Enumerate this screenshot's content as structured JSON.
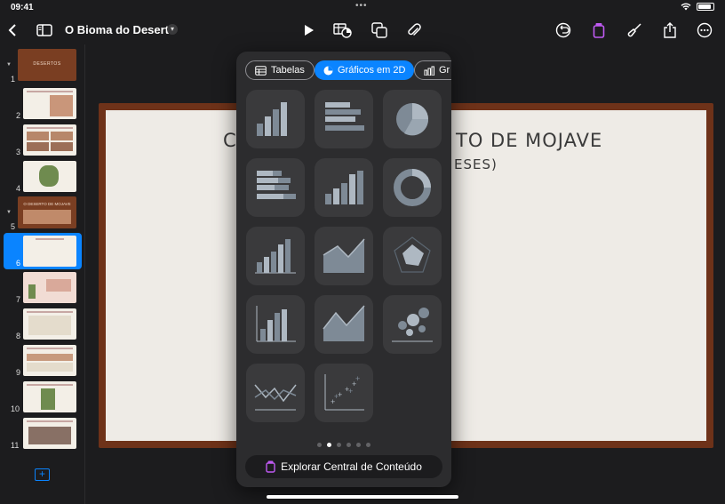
{
  "status_bar": {
    "time": "09:41",
    "dots": "•••"
  },
  "toolbar": {
    "title": "O Bioma do Deserto",
    "icons": [
      "chevron-left-icon",
      "sidebar-icon",
      "play-icon",
      "table-chart-icon",
      "shapes-icon",
      "paperclip-icon",
      "undo-icon",
      "content-hub-icon",
      "brush-icon",
      "share-icon",
      "more-icon"
    ]
  },
  "sidebar": {
    "slides": [
      {
        "num": "1",
        "label": "DESERTOS"
      },
      {
        "num": "2"
      },
      {
        "num": "3"
      },
      {
        "num": "4"
      },
      {
        "num": "5",
        "label": "O DESERTO DE MOJAVE"
      },
      {
        "num": "6"
      },
      {
        "num": "7"
      },
      {
        "num": "8"
      },
      {
        "num": "9"
      },
      {
        "num": "10"
      },
      {
        "num": "11"
      }
    ],
    "selected": "6"
  },
  "slide": {
    "title_left": "CL",
    "title_right": "TO DE MOJAVE",
    "subtitle": "ESES)"
  },
  "chart_picker": {
    "tabs": [
      {
        "label": "Tabelas",
        "active": false
      },
      {
        "label": "Gráficos em 2D",
        "active": true
      },
      {
        "label": "Gr",
        "active": false
      }
    ],
    "chart_types": [
      "column-chart",
      "bar-chart",
      "pie-chart",
      "stacked-bar-chart",
      "stacked-column-chart",
      "donut-chart",
      "column-axis-chart",
      "area-chart",
      "radar-chart",
      "column-axis-alt-chart",
      "area-axis-chart",
      "bubble-chart",
      "line-chart",
      "scatter-chart"
    ],
    "page_count": 6,
    "active_page": 2,
    "explore_label": "Explorar Central de Conteúdo"
  },
  "colors": {
    "accent": "#0a84ff",
    "slide_frame": "#6e3219",
    "slide_bg": "#eeebe6",
    "panel": "#2c2c2e"
  }
}
